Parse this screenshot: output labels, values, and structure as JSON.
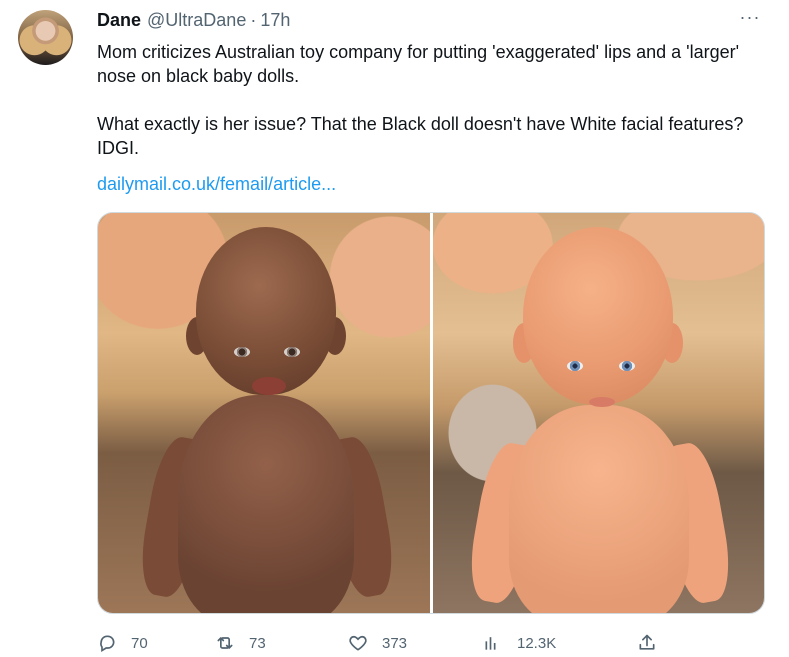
{
  "tweet": {
    "author_name": "Dane",
    "author_handle": "@UltraDane",
    "separator": "·",
    "time": "17h",
    "more_label": "···",
    "paragraph1": "Mom criticizes Australian toy company for putting 'exaggerated' lips and a 'larger' nose on black baby dolls.",
    "paragraph2": "What exactly is her issue? That the Black doll doesn't have White facial features? IDGI.",
    "link_text": "dailymail.co.uk/femail/article..."
  },
  "actions": {
    "replies": "70",
    "retweets": "73",
    "likes": "373",
    "views": "12.3K"
  },
  "icons": {
    "reply": "reply-icon",
    "retweet": "retweet-icon",
    "like": "heart-icon",
    "views": "analytics-icon",
    "share": "share-icon",
    "more": "more-icon"
  },
  "colors": {
    "text": "#0f1419",
    "secondary": "#536471",
    "link": "#1d9bf0"
  }
}
